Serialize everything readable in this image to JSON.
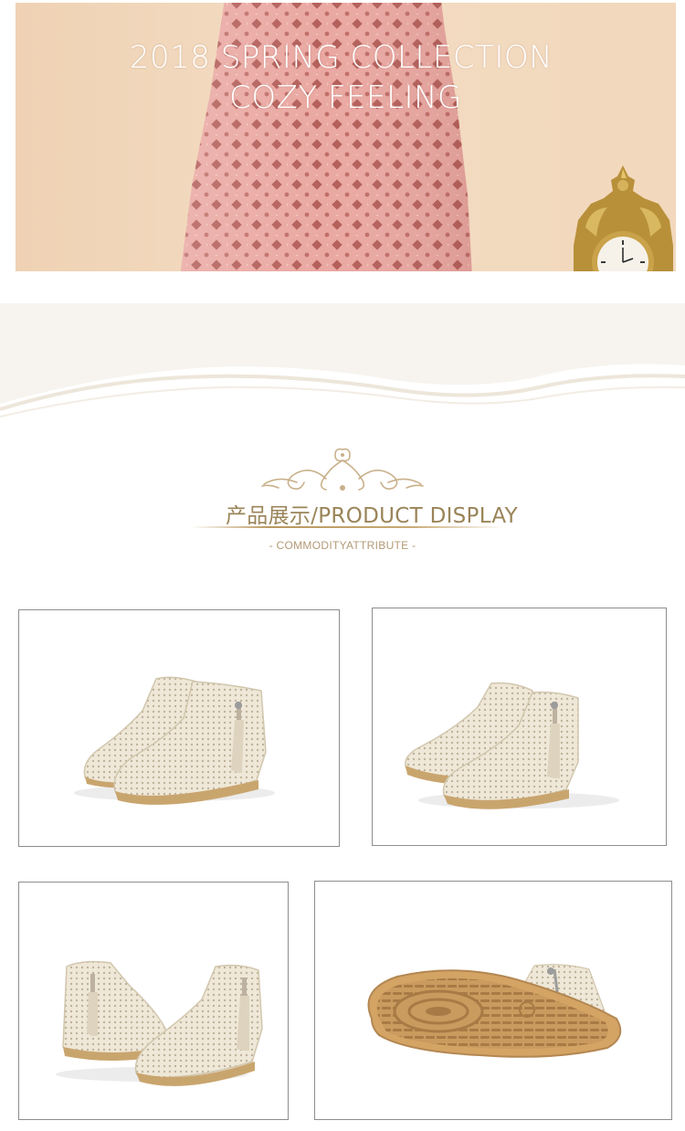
{
  "hero": {
    "line1": "2018 SPRING COLLECTION",
    "line2": "COZY FEELING",
    "colors": {
      "background": "#f2d8bc",
      "dress": "#eaa5a0",
      "text": "#ffffff",
      "clock_gold": "#b8903a"
    }
  },
  "section": {
    "title": "产品展示/PRODUCT DISPLAY",
    "subtitle": "- COMMODITYATTRIBUTE -",
    "colors": {
      "title": "#9a8458",
      "subtitle": "#b39a76",
      "ornament": "#c9b08a"
    }
  },
  "photos": [
    {
      "view": "pair-front-three-quarter"
    },
    {
      "view": "pair-front-angled"
    },
    {
      "view": "pair-side-tassel"
    },
    {
      "view": "sole-bottom"
    }
  ],
  "colors": {
    "boot": "#efe9dc",
    "sole": "#c9a56e",
    "frame_border": "#8d8d8d"
  }
}
